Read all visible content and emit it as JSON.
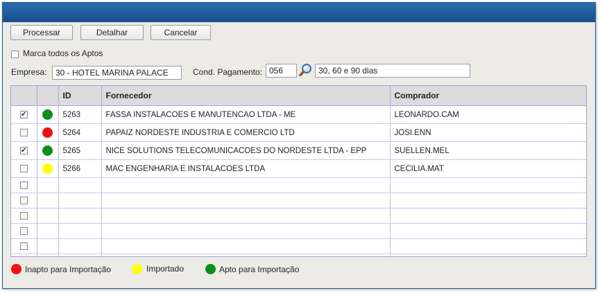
{
  "toolbar": {
    "processar_label": "Processar",
    "detalhar_label": "Detalhar",
    "cancelar_label": "Cancelar"
  },
  "select_all": {
    "label": "Marca todos os Aptos",
    "checked": false
  },
  "empresa": {
    "label": "Empresa:",
    "value": "30 - HOTEL MARINA PALACE"
  },
  "cond_pagamento": {
    "label": "Cond. Pagamento:",
    "code": "056",
    "description": "30, 60 e 90 dias",
    "search_icon": "magnifier-icon"
  },
  "grid": {
    "columns": [
      "",
      "",
      "ID",
      "Fornecedor",
      "Comprador"
    ],
    "rows": [
      {
        "checked": true,
        "status": "green",
        "id": "5263",
        "fornecedor": "FASSA INSTALACOES E MANUTENCAO LTDA - ME",
        "comprador": "LEONARDO.CAM"
      },
      {
        "checked": false,
        "status": "red",
        "id": "5264",
        "fornecedor": "PAPAIZ NORDESTE INDUSTRIA E COMERCIO LTD",
        "comprador": "JOSI.ENN"
      },
      {
        "checked": true,
        "status": "green",
        "id": "5265",
        "fornecedor": "NICE SOLUTIONS TELECOMUNICACOES DO NORDESTE LTDA - EPP",
        "comprador": "SUELLEN.MEL"
      },
      {
        "checked": false,
        "status": "yellow",
        "id": "5266",
        "fornecedor": "MAC ENGENHARIA E INSTALACOES LTDA",
        "comprador": "CECILIA.MAT"
      }
    ],
    "empty_rows": 6
  },
  "legend": {
    "inapto": "Inapto para Importação",
    "importado": "Importado",
    "apto": "Apto para Importação"
  },
  "colors": {
    "green": "#0a8f1f",
    "red": "#ee1111",
    "yellow": "#ffff00",
    "titlebar": "#1f5a96"
  }
}
